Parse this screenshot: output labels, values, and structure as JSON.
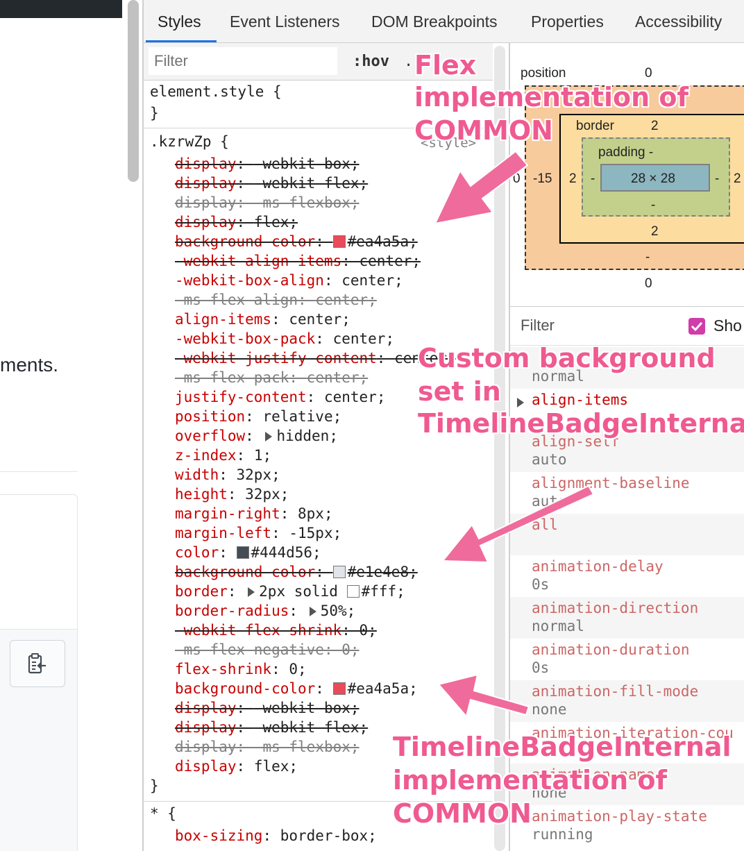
{
  "page": {
    "visible_text": "ments."
  },
  "tabs": [
    {
      "label": "Styles",
      "active": true
    },
    {
      "label": "Event Listeners",
      "active": false
    },
    {
      "label": "DOM Breakpoints",
      "active": false
    },
    {
      "label": "Properties",
      "active": false
    },
    {
      "label": "Accessibility",
      "active": false
    }
  ],
  "styles_toolbar": {
    "filter_placeholder": "Filter",
    "hov_label": ":hov",
    "cls_label": "."
  },
  "element_style": {
    "selector": "element.style {",
    "close": "}"
  },
  "rule": {
    "selector": ".kzrwZp {",
    "source": "<style>",
    "close": "}",
    "declarations": [
      {
        "prop": "display",
        "value": "-webkit-box",
        "state": "overridden"
      },
      {
        "prop": "display",
        "value": "-webkit-flex",
        "state": "overridden"
      },
      {
        "prop": "display",
        "value": "-ms-flexbox",
        "state": "invalid"
      },
      {
        "prop": "display",
        "value": "flex",
        "state": "overridden"
      },
      {
        "prop": "background-color",
        "value": "#ea4a5a",
        "state": "overridden",
        "swatch": "#ea4a5a"
      },
      {
        "prop": "-webkit-align-items",
        "value": "center",
        "state": "overridden"
      },
      {
        "prop": "-webkit-box-align",
        "value": "center",
        "state": "active"
      },
      {
        "prop": "-ms-flex-align",
        "value": "center",
        "state": "invalid"
      },
      {
        "prop": "align-items",
        "value": "center",
        "state": "active"
      },
      {
        "prop": "-webkit-box-pack",
        "value": "center",
        "state": "active"
      },
      {
        "prop": "-webkit-justify-content",
        "value": "center",
        "state": "overridden"
      },
      {
        "prop": "-ms-flex-pack",
        "value": "center",
        "state": "invalid"
      },
      {
        "prop": "justify-content",
        "value": "center",
        "state": "active"
      },
      {
        "prop": "position",
        "value": "relative",
        "state": "active"
      },
      {
        "prop": "overflow",
        "value": "hidden",
        "state": "active",
        "expand": true
      },
      {
        "prop": "z-index",
        "value": "1",
        "state": "active"
      },
      {
        "prop": "width",
        "value": "32px",
        "state": "active"
      },
      {
        "prop": "height",
        "value": "32px",
        "state": "active"
      },
      {
        "prop": "margin-right",
        "value": "8px",
        "state": "active"
      },
      {
        "prop": "margin-left",
        "value": "-15px",
        "state": "active"
      },
      {
        "prop": "color",
        "value": "#444d56",
        "state": "active",
        "swatch": "#444d56"
      },
      {
        "prop": "background-color",
        "value": "#e1e4e8",
        "state": "overridden",
        "swatch": "#e1e4e8"
      },
      {
        "prop": "border",
        "value": "2px solid #fff",
        "state": "active",
        "expand": true,
        "swatch": "#ffffff",
        "value_pre": "2px solid ",
        "value_post": "#fff"
      },
      {
        "prop": "border-radius",
        "value": "50%",
        "state": "active",
        "expand": true
      },
      {
        "prop": "-webkit-flex-shrink",
        "value": "0",
        "state": "overridden"
      },
      {
        "prop": "-ms-flex-negative",
        "value": "0",
        "state": "invalid"
      },
      {
        "prop": "flex-shrink",
        "value": "0",
        "state": "active"
      },
      {
        "prop": "background-color",
        "value": "#ea4a5a",
        "state": "active",
        "swatch": "#ea4a5a"
      },
      {
        "prop": "display",
        "value": "-webkit-box",
        "state": "overridden"
      },
      {
        "prop": "display",
        "value": "-webkit-flex",
        "state": "overridden"
      },
      {
        "prop": "display",
        "value": "-ms-flexbox",
        "state": "invalid"
      },
      {
        "prop": "display",
        "value": "flex",
        "state": "active"
      }
    ]
  },
  "universal_rule": {
    "selector": "* {",
    "declarations": [
      {
        "prop": "box-sizing",
        "value": "border-box",
        "state": "active"
      }
    ]
  },
  "box_model": {
    "position_label": "position",
    "position_top": "0",
    "position_bottom": "0",
    "position_left": "0",
    "margin_top": "-",
    "margin_left": "-15",
    "margin_bottom": "-",
    "border_label": "border",
    "border_top": "2",
    "border_left": "2",
    "border_right": "2",
    "border_bottom": "2",
    "padding_label": "padding -",
    "padding_left": "-",
    "padding_right": "-",
    "padding_bottom": "-",
    "content": "28 × 28"
  },
  "computed": {
    "filter_placeholder": "Filter",
    "show_all_label": "Sho",
    "show_all_checked": true,
    "rows": [
      {
        "name": "",
        "value": "normal",
        "alt": true
      },
      {
        "name": "align-items",
        "value": "",
        "expanded": true,
        "alt": false
      },
      {
        "name": "align-self",
        "value": "auto",
        "alt": true
      },
      {
        "name": "alignment-baseline",
        "value": "auto",
        "alt": false
      },
      {
        "name": "all",
        "value": "",
        "alt": true
      },
      {
        "name": "animation-delay",
        "value": "0s",
        "alt": false
      },
      {
        "name": "animation-direction",
        "value": "normal",
        "alt": true
      },
      {
        "name": "animation-duration",
        "value": "0s",
        "alt": false
      },
      {
        "name": "animation-fill-mode",
        "value": "none",
        "alt": true
      },
      {
        "name": "animation-iteration-cou",
        "value": "",
        "alt": false
      },
      {
        "name": "animation-name",
        "value": "none",
        "alt": true
      },
      {
        "name": "animation-play-state",
        "value": "running",
        "alt": false
      }
    ]
  },
  "annotations": {
    "flex_common": [
      "Flex",
      "implementation of",
      "COMMON"
    ],
    "custom_background": [
      "Custom background",
      "set in",
      "TimelineBadgeInternal"
    ],
    "timeline_common": [
      "TimelineBadgeInternal",
      "implementation of",
      "COMMON"
    ],
    "color": "#ef5a90"
  }
}
